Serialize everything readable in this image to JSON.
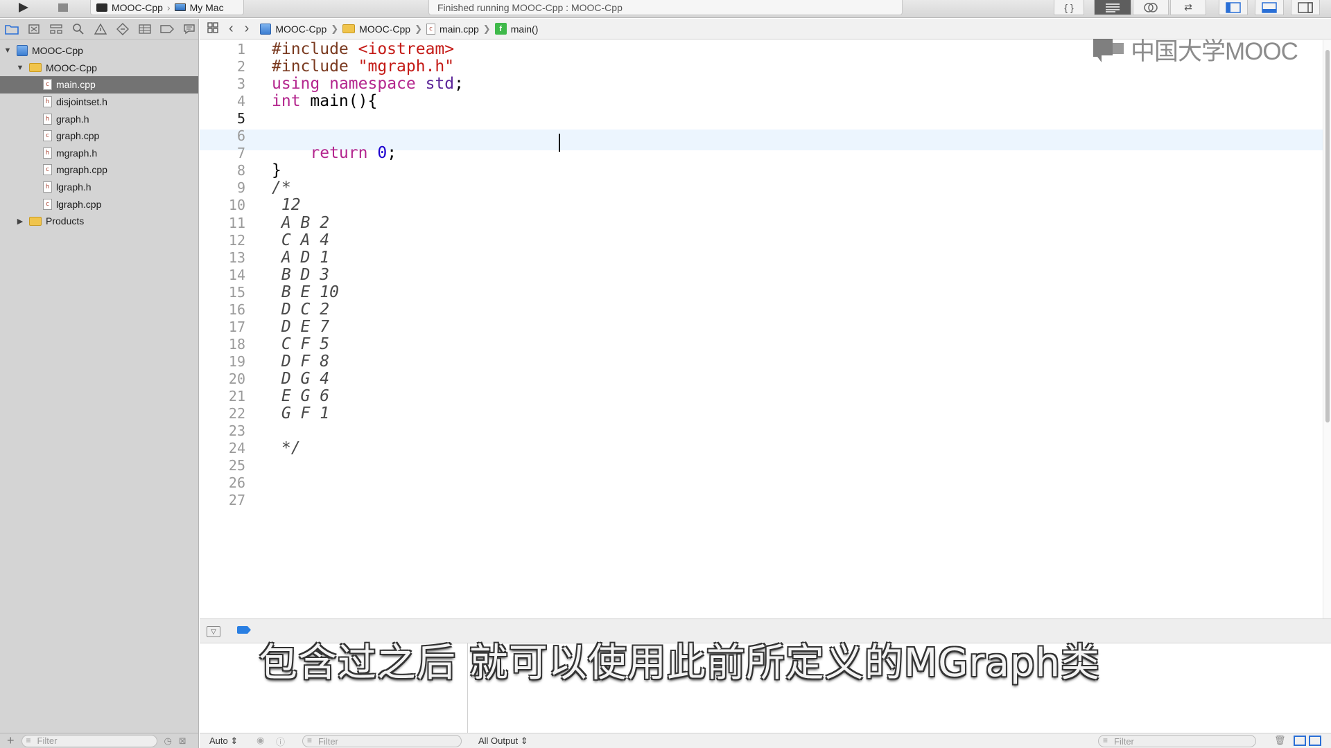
{
  "toolbar": {
    "scheme_target": "MOOC-Cpp",
    "destination": "My Mac",
    "status_text": "Finished running MOOC-Cpp : MOOC-Cpp"
  },
  "navigator": {
    "project": "MOOC-Cpp",
    "group": "MOOC-Cpp",
    "files": [
      {
        "name": "main.cpp",
        "type": "cpp"
      },
      {
        "name": "disjointset.h",
        "type": "h"
      },
      {
        "name": "graph.h",
        "type": "h"
      },
      {
        "name": "graph.cpp",
        "type": "cpp"
      },
      {
        "name": "mgraph.h",
        "type": "h"
      },
      {
        "name": "mgraph.cpp",
        "type": "cpp"
      },
      {
        "name": "lgraph.h",
        "type": "h"
      },
      {
        "name": "lgraph.cpp",
        "type": "cpp"
      }
    ],
    "products": "Products",
    "filter_placeholder": "Filter"
  },
  "jumpbar": {
    "project": "MOOC-Cpp",
    "group": "MOOC-Cpp",
    "file": "main.cpp",
    "symbol": "main()"
  },
  "editor": {
    "current_line": 5,
    "lines": [
      "#include <iostream>",
      "#include \"mgraph.h\"",
      "using namespace std;",
      "int main(){",
      "",
      "",
      "    return 0;",
      "}",
      "/*",
      " 12",
      " A B 2",
      " C A 4",
      " A D 1",
      " B D 3",
      " B E 10",
      " D C 2",
      " D E 7",
      " C F 5",
      " D F 8",
      " D G 4",
      " E G 6",
      " G F 1",
      "",
      " */",
      "",
      "",
      ""
    ],
    "line_numbers": [
      "1",
      "2",
      "3",
      "4",
      "5",
      "6",
      "7",
      "8",
      "9",
      "10",
      "11",
      "12",
      "13",
      "14",
      "15",
      "16",
      "17",
      "18",
      "19",
      "20",
      "21",
      "22",
      "23",
      "24",
      "25",
      "26",
      "27"
    ]
  },
  "debug": {
    "auto_label": "Auto ⇕",
    "filter_placeholder": "Filter",
    "output_label": "All Output ⇕",
    "right_filter_placeholder": "Filter"
  },
  "watermark": {
    "text": "中国大学MOOC"
  },
  "subtitle": "包含过之后 就可以使用此前所定义的MGraph类"
}
